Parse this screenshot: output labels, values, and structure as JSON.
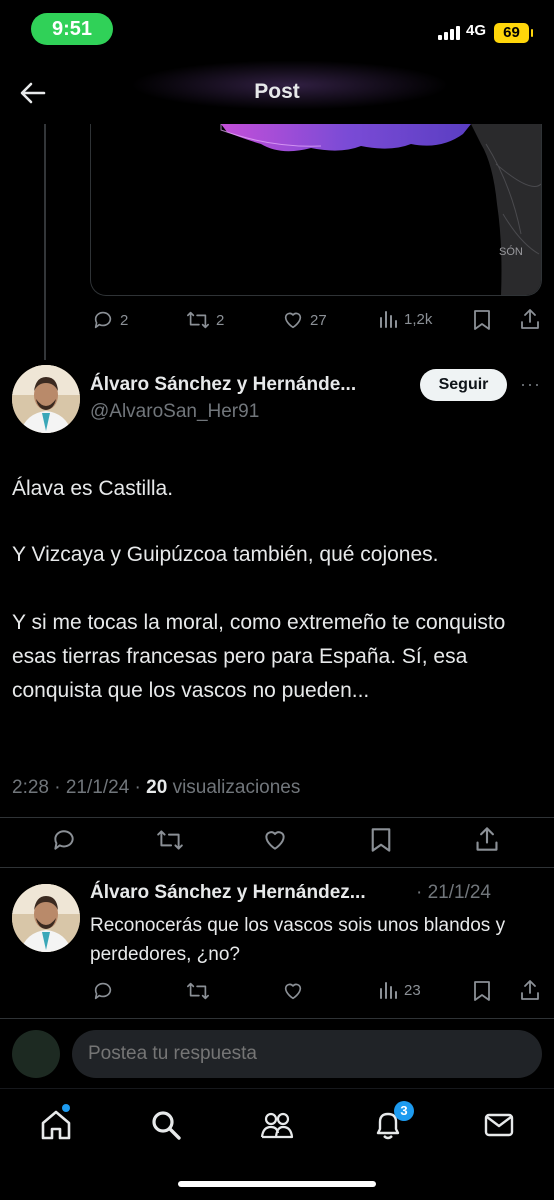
{
  "status_bar": {
    "time": "9:51",
    "network": "4G",
    "battery": "69"
  },
  "header": {
    "title": "Post"
  },
  "previous_post": {
    "map_label": "SÓN",
    "actions": {
      "replies": "2",
      "reposts": "2",
      "likes": "27",
      "views": "1,2k"
    }
  },
  "main_post": {
    "author_name": "Álvaro Sánchez y Hernánde...",
    "handle": "@AlvaroSan_Her91",
    "follow_label": "Seguir",
    "paragraphs": [
      "Álava es Castilla.",
      "Y Vizcaya y Guipúzcoa también, qué cojones.",
      "Y si me tocas la moral, como extremeño te conquisto esas tierras francesas pero para España. Sí, esa conquista que los vascos no pueden..."
    ],
    "meta_time": "2:28 · 21/1/24 · ",
    "meta_views_count": "20",
    "meta_views_label": " visualizaciones"
  },
  "reply": {
    "author_name": "Álvaro Sánchez y Hernández...",
    "date": "· 21/1/24",
    "text": "Reconocerás que los vascos sois unos blandos y perdedores, ¿no?",
    "views": "23"
  },
  "compose": {
    "placeholder": "Postea tu respuesta"
  },
  "bottom_nav": {
    "notifications_badge": "3"
  }
}
